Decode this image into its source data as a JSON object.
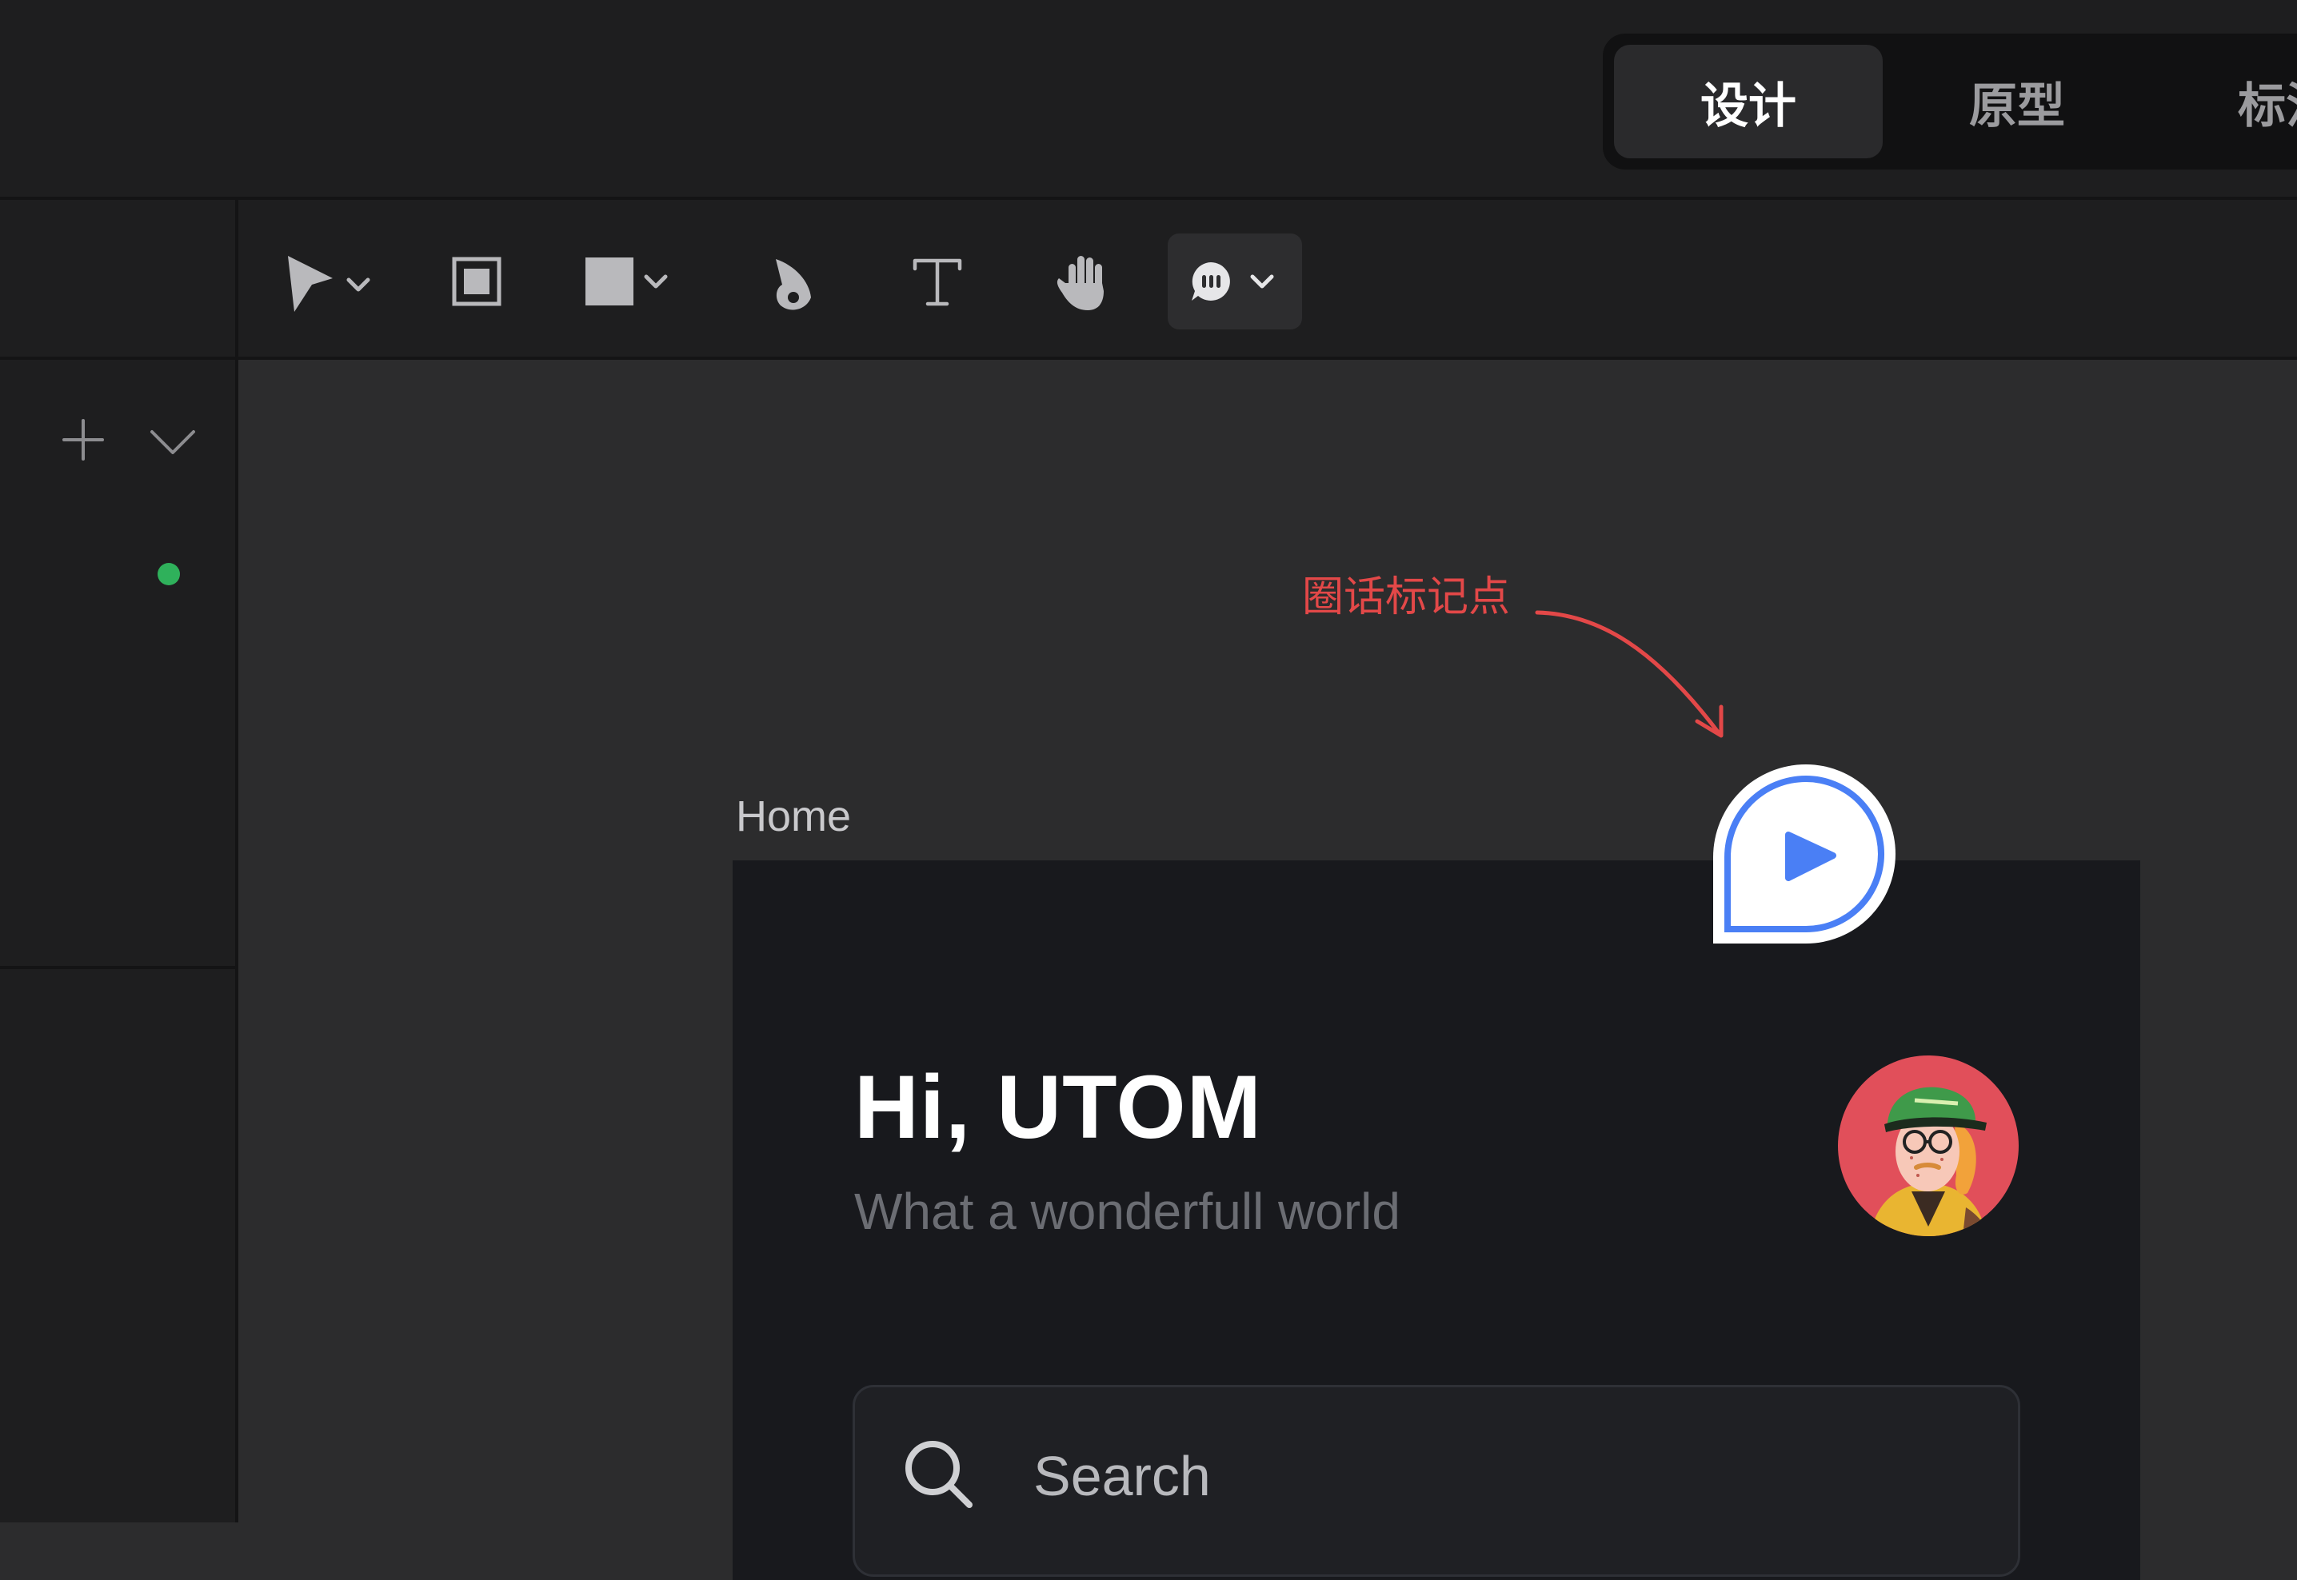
{
  "mode_tabs": [
    {
      "label": "设计",
      "active": true
    },
    {
      "label": "原型",
      "active": false
    },
    {
      "label": "标注",
      "active": false
    }
  ],
  "toolbar": {
    "tools": [
      "move-tool",
      "frame-tool",
      "shape-tool",
      "pen-tool",
      "text-tool",
      "hand-tool",
      "comment-tool"
    ],
    "active_tool": "comment-tool"
  },
  "canvas": {
    "frame_name": "Home",
    "greeting": "Hi, UTOM",
    "subtitle": "What a wonderfull world",
    "search_placeholder": "Search"
  },
  "annotation": {
    "label": "圈话标记点"
  },
  "colors": {
    "accent": "#4a7ff5",
    "annotation": "#e34848",
    "status_online": "#2fb15b",
    "avatar_bg": "#e14f5a"
  }
}
